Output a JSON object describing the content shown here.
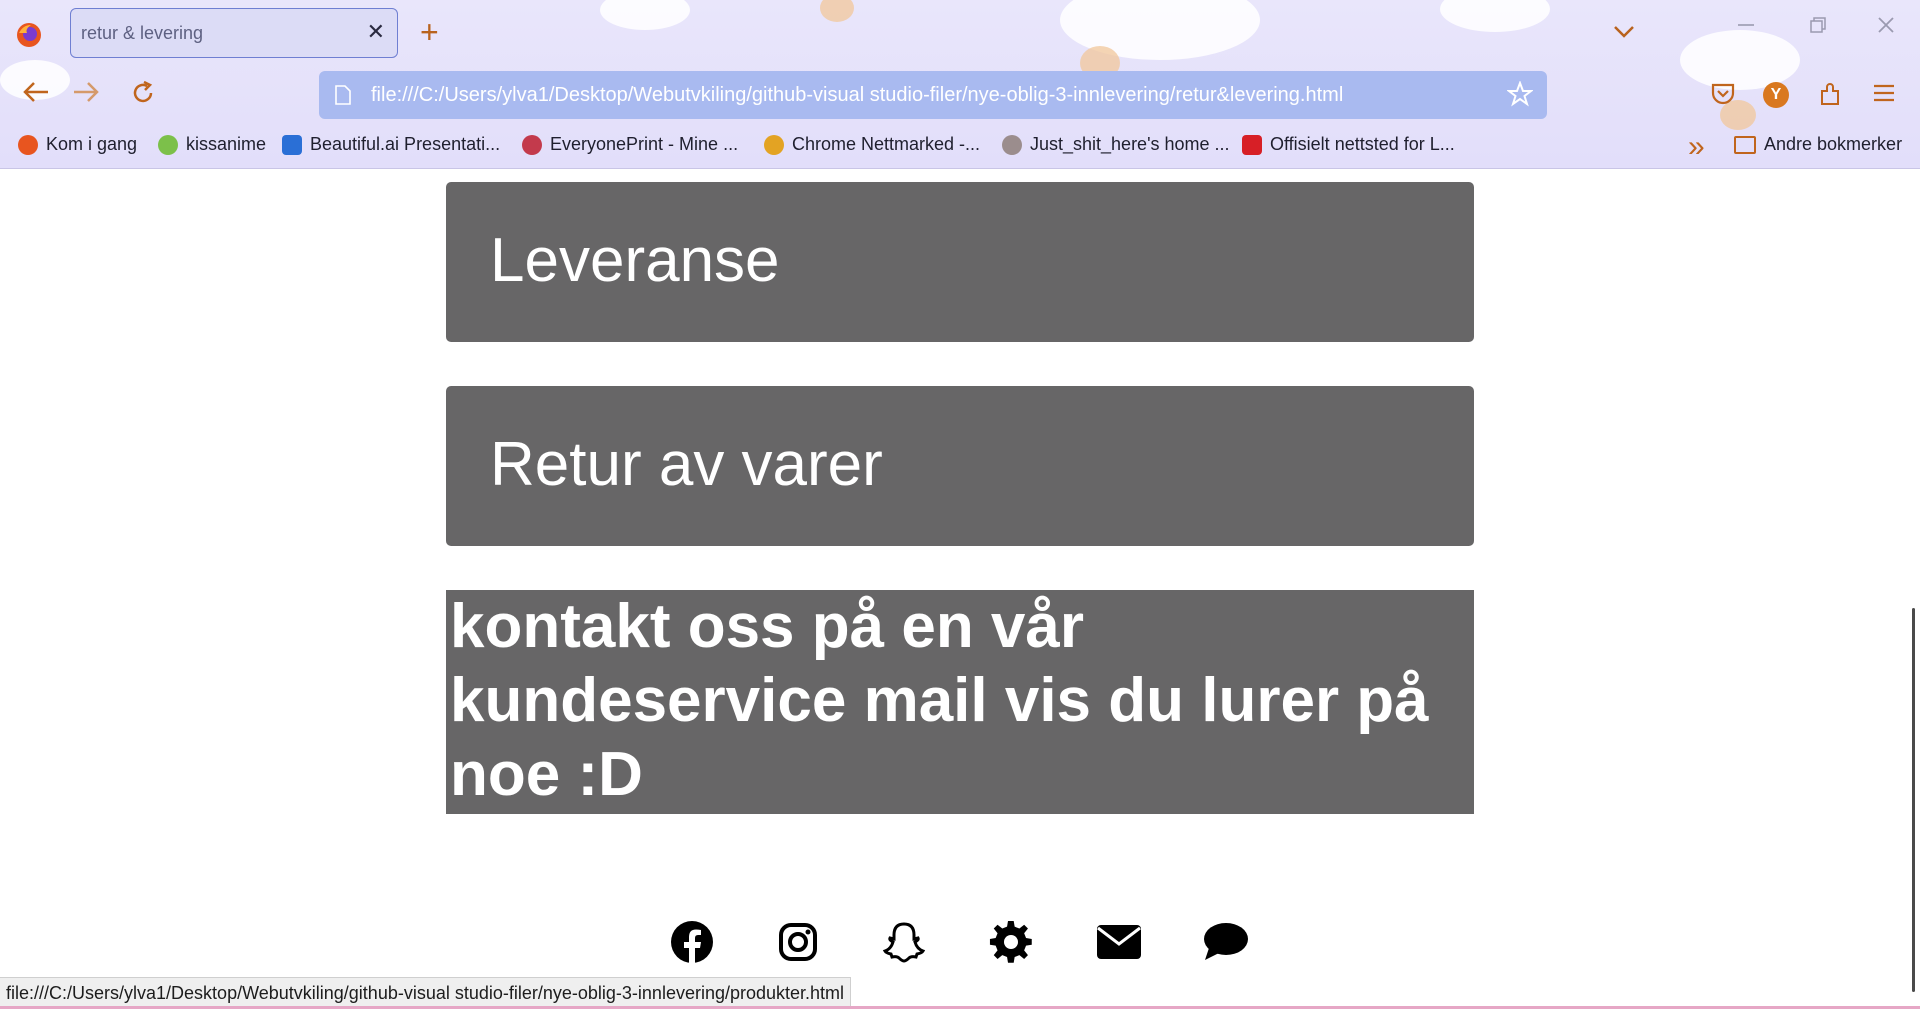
{
  "browser": {
    "tab_title": "retur & levering",
    "tab_close": "✕",
    "new_tab": "+",
    "list_tabs": "⌄",
    "url": "file:///C:/Users/ylva1/Desktop/Webutvkiling/github-visual studio-filer/nye-oblig-3-innlevering/retur&levering.html",
    "account_initial": "Y",
    "bookmarks": [
      {
        "label": "Kom i gang",
        "icon": "firefox-icon",
        "color": "#e8551f"
      },
      {
        "label": "kissanime",
        "icon": "kissanime-icon",
        "color": "#7cc04a"
      },
      {
        "label": "Beautiful.ai Presentati...",
        "icon": "beautifulai-icon",
        "color": "#2a6fd6"
      },
      {
        "label": "EveryonePrint - Mine ...",
        "icon": "everyoneprint-icon",
        "color": "#c33a4c"
      },
      {
        "label": "Chrome Nettmarked -...",
        "icon": "chrome-webstore-icon",
        "color": "#e3a323"
      },
      {
        "label": "Just_shit_here's home ...",
        "icon": "reddit-icon",
        "color": "#9b8d8d"
      },
      {
        "label": "Offisielt nettsted for L...",
        "icon": "l-brand-icon",
        "color": "#d71f26"
      }
    ],
    "other_bookmarks": "Andre bokmerker",
    "overflow": "»",
    "status_url": "file:///C:/Users/ylva1/Desktop/Webutvkiling/github-visual studio-filer/nye-oblig-3-innlevering/produkter.html"
  },
  "page": {
    "sections": [
      {
        "title": "Leveranse"
      },
      {
        "title": "Retur av varer"
      }
    ],
    "contact_text": "kontakt oss på en vår kundeservice mail vis du lurer på noe :D",
    "footer_icons": [
      "facebook-icon",
      "instagram-icon",
      "snapchat-icon",
      "settings-gear-icon",
      "mail-icon",
      "chat-bubble-icon"
    ]
  },
  "colors": {
    "card_bg": "#676667",
    "chrome_bg": "#e9e6fb",
    "url_bar": "#a9baf0",
    "accent_orange": "#c0651d"
  }
}
